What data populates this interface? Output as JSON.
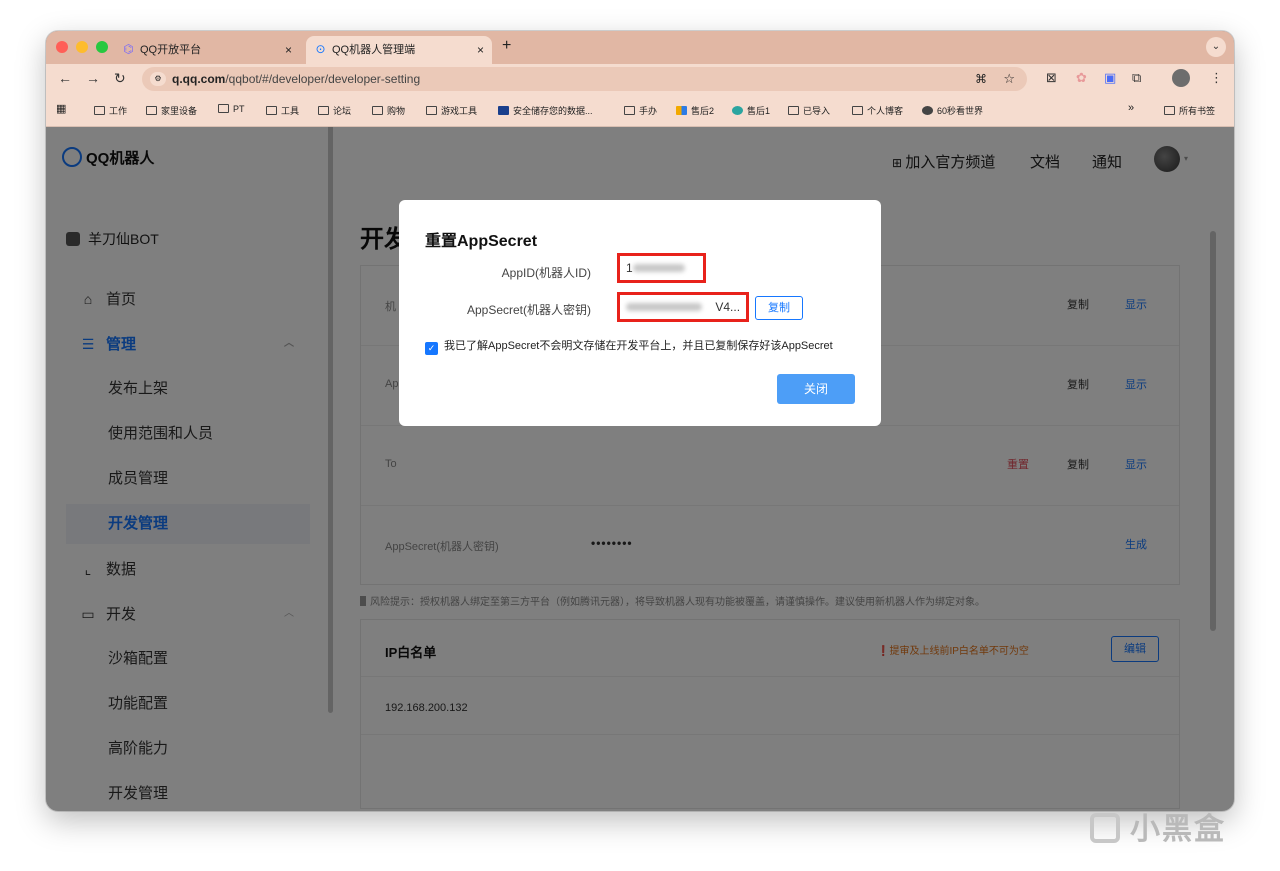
{
  "browser": {
    "tabs": [
      {
        "label": "QQ开放平台",
        "icon": "qq-open-icon"
      },
      {
        "label": "QQ机器人管理端",
        "icon": "qq-bot-icon"
      }
    ],
    "tab_close": "×",
    "new_tab": "+",
    "url_host": "q.qq.com",
    "url_path": "/qqbot/#/developer/developer-setting",
    "bookmarks": [
      "工作",
      "家里设备",
      "PT",
      "工具",
      "论坛",
      "购物",
      "游戏工具",
      "安全储存您的数据...",
      "手办",
      "售后2",
      "售后1",
      "已导入",
      "个人博客",
      "60秒看世界"
    ],
    "bookmarks_more": "»",
    "all_bookmarks": "所有书签"
  },
  "header": {
    "logo": "QQ机器人",
    "join_channel": "加入官方频道",
    "docs": "文档",
    "notify": "通知"
  },
  "sidebar": {
    "bot_name": "羊刀仙BOT",
    "items": [
      {
        "label": "首页"
      },
      {
        "label": "管理"
      },
      {
        "label": "发布上架"
      },
      {
        "label": "使用范围和人员"
      },
      {
        "label": "成员管理"
      },
      {
        "label": "开发管理"
      },
      {
        "label": "数据"
      },
      {
        "label": "开发"
      },
      {
        "label": "沙箱配置"
      },
      {
        "label": "功能配置"
      },
      {
        "label": "高阶能力"
      },
      {
        "label": "开发管理"
      }
    ]
  },
  "main": {
    "title": "开发管理",
    "row1_label": "机",
    "row2_label": "Ap",
    "row3_label": "To",
    "secret_label": "AppSecret(机器人密钥)",
    "secret_masked": "••••••••",
    "copy": "复制",
    "show": "显示",
    "reset": "重置",
    "generate": "生成",
    "risk_note": "风险提示：授权机器人绑定至第三方平台（例如腾讯元器），将导致机器人现有功能被覆盖，请谨慎操作。建议使用新机器人作为绑定对象。",
    "ip_title": "IP白名单",
    "ip_warning": "提审及上线前IP白名单不可为空",
    "edit": "编辑",
    "ip_value": "192.168.200.132"
  },
  "modal": {
    "title": "重置AppSecret",
    "appid_label": "AppID(机器人ID)",
    "appid_visible_prefix": "1",
    "secret_label": "AppSecret(机器人密钥)",
    "secret_visible_suffix": "V4...",
    "copy": "复制",
    "checkbox_text": "我已了解AppSecret不会明文存储在开发平台上，并且已复制保存好该AppSecret",
    "close": "关闭"
  },
  "watermark": "小黑盒"
}
